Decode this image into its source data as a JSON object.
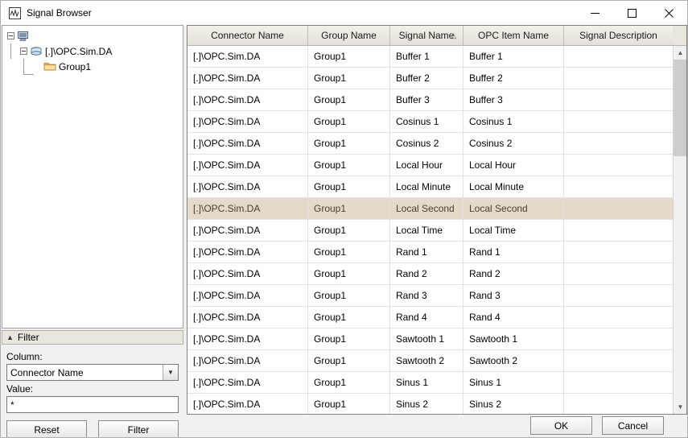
{
  "window": {
    "title": "Signal Browser",
    "icon": "app-waveform-icon",
    "minimize_label": "—",
    "maximize_label": "□",
    "close_label": "✕"
  },
  "tree": {
    "root_label": "",
    "nodes": [
      {
        "label": "[.]\\OPC.Sim.DA",
        "icon": "server-icon"
      },
      {
        "label": "Group1",
        "icon": "folder-icon"
      }
    ]
  },
  "filter": {
    "header": "Filter",
    "collapse_icon": "chevron-up-icon",
    "column_label": "Column:",
    "column_value": "Connector Name",
    "column_dropdown_icon": "chevron-down-icon",
    "value_label": "Value:",
    "value_text": "*",
    "reset_button": "Reset",
    "filter_button": "Filter"
  },
  "grid": {
    "columns": [
      {
        "key": "connector",
        "label": "Connector Name",
        "sorted": false,
        "sort_icon": ""
      },
      {
        "key": "group",
        "label": "Group Name",
        "sorted": false,
        "sort_icon": ""
      },
      {
        "key": "signal",
        "label": "Signal Name",
        "sorted": true,
        "sort_icon": "△"
      },
      {
        "key": "opcitem",
        "label": "OPC Item Name",
        "sorted": false,
        "sort_icon": ""
      },
      {
        "key": "description",
        "label": "Signal Description",
        "sorted": false,
        "sort_icon": ""
      }
    ],
    "selected_row_index": 7,
    "rows": [
      {
        "connector": "[.]\\OPC.Sim.DA",
        "group": "Group1",
        "signal": "Buffer 1",
        "opcitem": "Buffer 1",
        "description": ""
      },
      {
        "connector": "[.]\\OPC.Sim.DA",
        "group": "Group1",
        "signal": "Buffer 2",
        "opcitem": "Buffer 2",
        "description": ""
      },
      {
        "connector": "[.]\\OPC.Sim.DA",
        "group": "Group1",
        "signal": "Buffer 3",
        "opcitem": "Buffer 3",
        "description": ""
      },
      {
        "connector": "[.]\\OPC.Sim.DA",
        "group": "Group1",
        "signal": "Cosinus 1",
        "opcitem": "Cosinus 1",
        "description": ""
      },
      {
        "connector": "[.]\\OPC.Sim.DA",
        "group": "Group1",
        "signal": "Cosinus 2",
        "opcitem": "Cosinus 2",
        "description": ""
      },
      {
        "connector": "[.]\\OPC.Sim.DA",
        "group": "Group1",
        "signal": "Local Hour",
        "opcitem": "Local Hour",
        "description": ""
      },
      {
        "connector": "[.]\\OPC.Sim.DA",
        "group": "Group1",
        "signal": "Local Minute",
        "opcitem": "Local Minute",
        "description": ""
      },
      {
        "connector": "[.]\\OPC.Sim.DA",
        "group": "Group1",
        "signal": "Local Second",
        "opcitem": "Local Second",
        "description": ""
      },
      {
        "connector": "[.]\\OPC.Sim.DA",
        "group": "Group1",
        "signal": "Local Time",
        "opcitem": "Local Time",
        "description": ""
      },
      {
        "connector": "[.]\\OPC.Sim.DA",
        "group": "Group1",
        "signal": "Rand 1",
        "opcitem": "Rand 1",
        "description": ""
      },
      {
        "connector": "[.]\\OPC.Sim.DA",
        "group": "Group1",
        "signal": "Rand 2",
        "opcitem": "Rand 2",
        "description": ""
      },
      {
        "connector": "[.]\\OPC.Sim.DA",
        "group": "Group1",
        "signal": "Rand 3",
        "opcitem": "Rand 3",
        "description": ""
      },
      {
        "connector": "[.]\\OPC.Sim.DA",
        "group": "Group1",
        "signal": "Rand 4",
        "opcitem": "Rand 4",
        "description": ""
      },
      {
        "connector": "[.]\\OPC.Sim.DA",
        "group": "Group1",
        "signal": "Sawtooth 1",
        "opcitem": "Sawtooth 1",
        "description": ""
      },
      {
        "connector": "[.]\\OPC.Sim.DA",
        "group": "Group1",
        "signal": "Sawtooth 2",
        "opcitem": "Sawtooth 2",
        "description": ""
      },
      {
        "connector": "[.]\\OPC.Sim.DA",
        "group": "Group1",
        "signal": "Sinus 1",
        "opcitem": "Sinus 1",
        "description": ""
      },
      {
        "connector": "[.]\\OPC.Sim.DA",
        "group": "Group1",
        "signal": "Sinus 2",
        "opcitem": "Sinus 2",
        "description": ""
      }
    ],
    "scrollbar": {
      "up_icon": "▲",
      "down_icon": "▼"
    }
  },
  "dialog_buttons": {
    "ok": "OK",
    "cancel": "Cancel"
  },
  "colors": {
    "selection": "#e5d9c9",
    "header_bg": "#e9e6de",
    "window_bg": "#f0f0f0",
    "border": "#828282"
  }
}
